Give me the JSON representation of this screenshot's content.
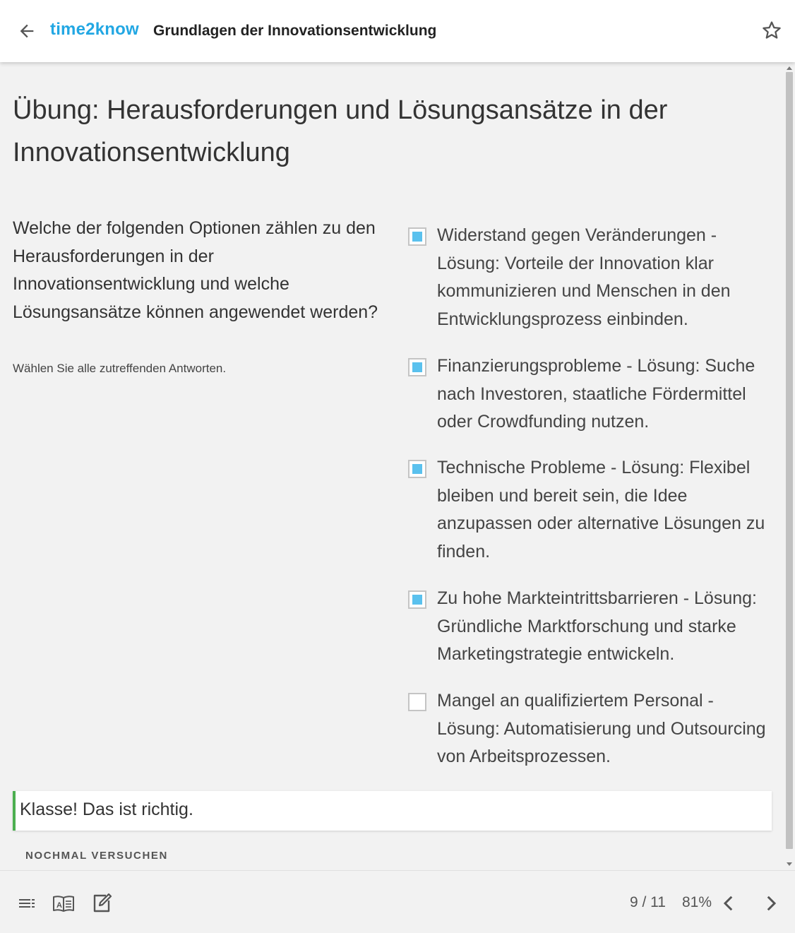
{
  "header": {
    "brand": "time2know",
    "course_title": "Grundlagen der Innovationsentwicklung",
    "back_icon": "arrow-left-icon",
    "favorite_icon": "star-outline-icon"
  },
  "exercise": {
    "title": "Übung: Herausforderungen und Lösungsansätze in der Innovationsentwicklung",
    "question": "Welche der folgenden Optionen zählen zu den Herausforderungen in der Innovationsentwicklung und welche Lösungsansätze können angewendet werden?",
    "hint": "Wählen Sie alle zutreffenden Antworten.",
    "options": [
      {
        "label": "Widerstand gegen Veränderungen - Lösung: Vorteile der Innovation klar kommunizieren und Menschen in den Entwicklungsprozess einbinden.",
        "checked": true
      },
      {
        "label": "Finanzierungsprobleme - Lösung: Suche nach Investoren, staatliche Fördermittel oder Crowdfunding nutzen.",
        "checked": true
      },
      {
        "label": "Technische Probleme - Lösung: Flexibel bleiben und bereit sein, die Idee anzupassen oder alternative Lösungen zu finden.",
        "checked": true
      },
      {
        "label": "Zu hohe Markteintrittsbarrieren - Lösung: Gründliche Marktforschung und starke Marketingstrategie entwickeln.",
        "checked": true
      },
      {
        "label": "Mangel an qualifiziertem Personal - Lösung: Automatisierung und Outsourcing von Arbeitsprozessen.",
        "checked": false
      }
    ],
    "feedback": "Klasse! Das ist richtig.",
    "retry_label": "NOCHMAL VERSUCHEN"
  },
  "footer": {
    "icons": [
      "table-of-contents-icon",
      "glossary-book-icon",
      "notes-edit-icon"
    ],
    "pages": "9 / 11",
    "percent": "81%",
    "prev_icon": "chevron-left-icon",
    "next_icon": "chevron-right-icon"
  },
  "colors": {
    "brand": "#22a7e3",
    "checkbox_fill": "#5ac1ee",
    "success": "#4caf50"
  }
}
